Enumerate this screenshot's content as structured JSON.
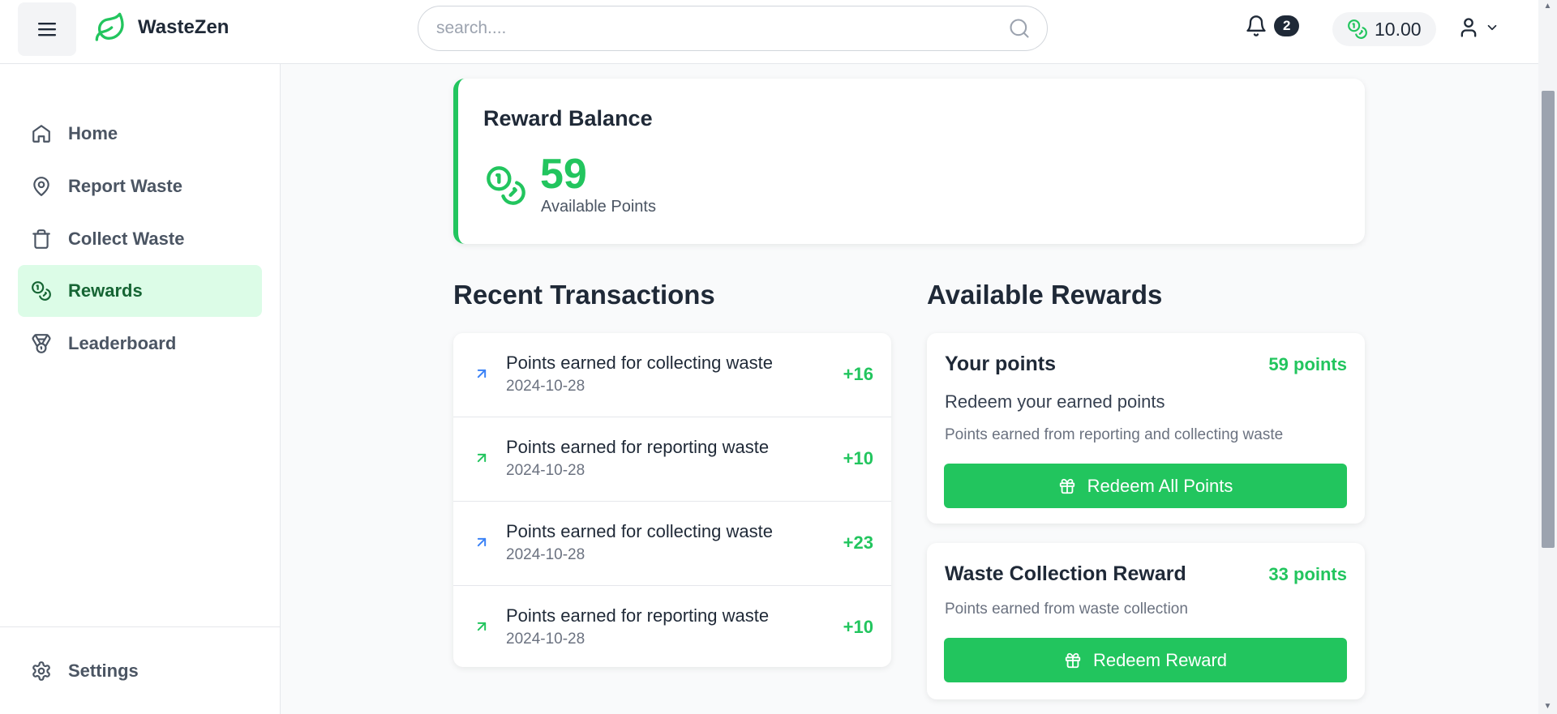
{
  "header": {
    "app_name": "WasteZen",
    "search_placeholder": "search....",
    "notification_count": "2",
    "balance": "10.00"
  },
  "sidebar": {
    "items": [
      {
        "label": "Home",
        "icon": "home-icon"
      },
      {
        "label": "Report Waste",
        "icon": "map-pin-icon"
      },
      {
        "label": "Collect Waste",
        "icon": "trash-icon"
      },
      {
        "label": "Rewards",
        "icon": "coins-icon",
        "active": true
      },
      {
        "label": "Leaderboard",
        "icon": "medal-icon"
      }
    ],
    "settings_label": "Settings"
  },
  "reward_balance": {
    "title": "Reward Balance",
    "points": "59",
    "subtitle": "Available Points"
  },
  "transactions": {
    "title": "Recent Transactions",
    "items": [
      {
        "description": "Points earned for collecting waste",
        "date": "2024-10-28",
        "amount": "+16",
        "kind": "collect"
      },
      {
        "description": "Points earned for reporting waste",
        "date": "2024-10-28",
        "amount": "+10",
        "kind": "report"
      },
      {
        "description": "Points earned for collecting waste",
        "date": "2024-10-28",
        "amount": "+23",
        "kind": "collect"
      },
      {
        "description": "Points earned for reporting waste",
        "date": "2024-10-28",
        "amount": "+10",
        "kind": "report"
      }
    ]
  },
  "rewards": {
    "title": "Available Rewards",
    "items": [
      {
        "name": "Your points",
        "points": "59 points",
        "line": "Redeem your earned points",
        "description": "Points earned from reporting and collecting waste",
        "button": "Redeem All Points"
      },
      {
        "name": "Waste Collection Reward",
        "points": "33 points",
        "description": "Points earned from waste collection",
        "button": "Redeem Reward"
      }
    ]
  },
  "colors": {
    "accent": "#22c55e",
    "active_nav_bg": "#dcfce7",
    "collect_arrow": "#3b82f6",
    "report_arrow": "#22c55e"
  }
}
